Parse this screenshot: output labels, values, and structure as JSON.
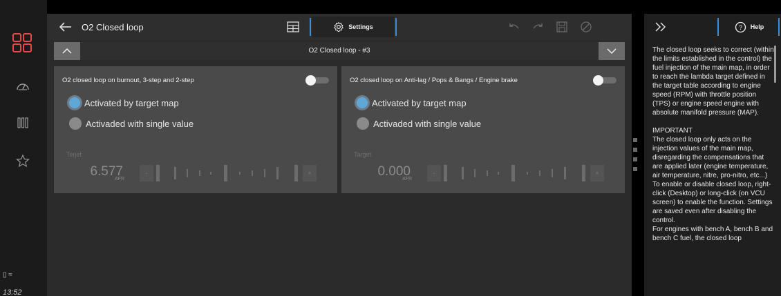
{
  "rail": {
    "items": [
      {
        "name": "dashboard-gauge-icon"
      },
      {
        "name": "columns-icon"
      },
      {
        "name": "star-icon"
      }
    ],
    "status_icons": "▯ ≈",
    "time": "13:52"
  },
  "header": {
    "title": "O2 Closed loop",
    "settings_label": "Settings"
  },
  "subheader": {
    "title": "O2 Closed loop - #3"
  },
  "cards": [
    {
      "title": "O2 closed loop on burnout, 3-step and 2-step",
      "toggle_on": false,
      "radio_1": "Activated by target map",
      "radio_2": "Activaded with single value",
      "selected": 1,
      "field_label": "Terjet",
      "value": "6.577",
      "unit": "AFR",
      "minus": "-",
      "plus": "+"
    },
    {
      "title": "O2 closed loop on Anti-lag / Pops & Bangs / Engine brake",
      "toggle_on": false,
      "radio_1": "Activated by target map",
      "radio_2": "Activaded with single value",
      "selected": 1,
      "field_label": "Target",
      "value": "0.000",
      "unit": "AFR",
      "minus": "-",
      "plus": "+"
    }
  ],
  "help": {
    "tab_label": "Help",
    "paragraphs": [
      "The closed loop seeks to correct (within the limits established in the control) the fuel injection of the main map, in order to reach the lambda target defined in the target table according to engine speed (RPM) with throttle position (TPS) or engine speed engine with absolute manifold pressure (MAP).",
      "IMPORTANT\nThe closed loop only acts on the injection values of the main map, disregarding the compensations that are applied later (engine temperature, air temperature, nitre, pro-nitro, etc...)\nTo enable or disable closed loop, right-click (Desktop) or long-click (on VCU screen) to enable the function. Settings are saved even after disabling the control.\nFor engines with bench A, bench B and bench C fuel, the closed loop"
    ]
  },
  "colors": {
    "accent": "#3a8fd9",
    "logo": "#e54a4a",
    "radio_on": "#5fa7d6"
  }
}
